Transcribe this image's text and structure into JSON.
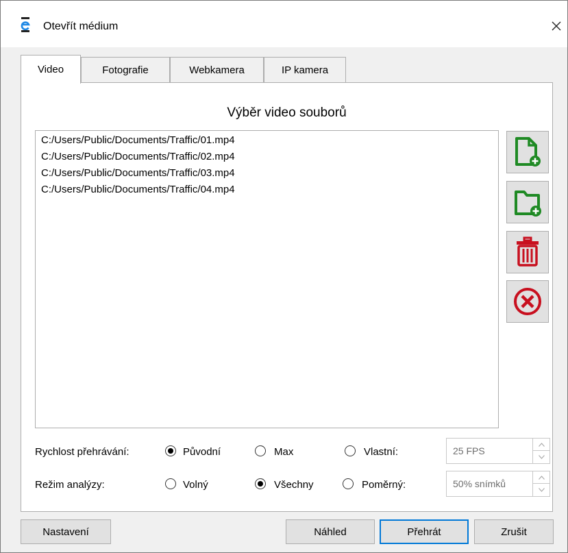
{
  "window": {
    "title": "Otevřít médium"
  },
  "tabs": [
    {
      "label": "Video"
    },
    {
      "label": "Fotografie"
    },
    {
      "label": "Webkamera"
    },
    {
      "label": "IP kamera"
    }
  ],
  "video": {
    "heading": "Výběr video souborů",
    "files": [
      "C:/Users/Public/Documents/Traffic/01.mp4",
      "C:/Users/Public/Documents/Traffic/02.mp4",
      "C:/Users/Public/Documents/Traffic/03.mp4",
      "C:/Users/Public/Documents/Traffic/04.mp4"
    ],
    "side_buttons": [
      "add-file-icon",
      "add-folder-icon",
      "trash-icon",
      "clear-icon"
    ]
  },
  "playback_speed": {
    "label": "Rychlost přehrávání:",
    "options": [
      "Původní",
      "Max",
      "Vlastní:"
    ],
    "selected": "Původní",
    "custom_value": "25 FPS"
  },
  "analysis_mode": {
    "label": "Režim analýzy:",
    "options": [
      "Volný",
      "Všechny",
      "Poměrný:"
    ],
    "selected": "Všechny",
    "ratio_value": "50% snímků"
  },
  "footer": {
    "settings_label": "Nastavení",
    "preview_label": "Náhled",
    "play_label": "Přehrát",
    "cancel_label": "Zrušit"
  },
  "colors": {
    "accent": "#0078d7",
    "green_icon": "#1f8a24",
    "red_icon": "#c8101f"
  }
}
